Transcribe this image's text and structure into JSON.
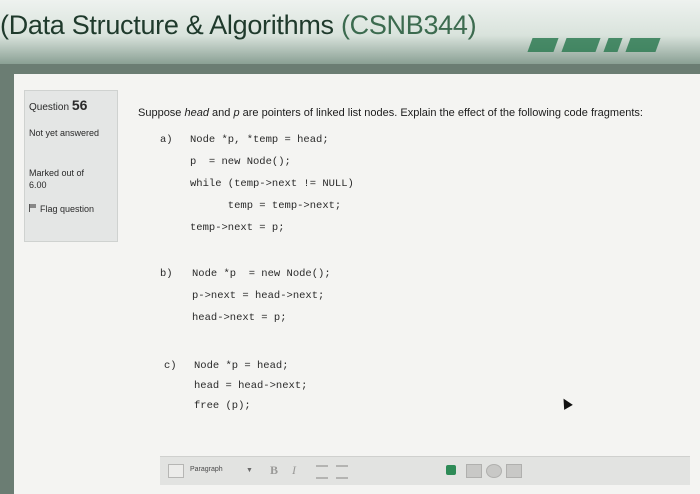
{
  "banner": {
    "title_main": "(Data Structure & Algorithms ",
    "title_code": "(CSNB344)"
  },
  "info": {
    "question_label": "Question",
    "question_number": "56",
    "status": "Not yet answered",
    "marked_out_of": "Marked out of",
    "marks": "6.00",
    "flag_label": "Flag question"
  },
  "prompt": {
    "before_head": "Suppose ",
    "head": "head",
    "mid": " and ",
    "p": "p",
    "after": " are pointers of linked list nodes. Explain the effect of the following code fragments:"
  },
  "fragments": {
    "a_label": "a)",
    "a_lines": [
      "Node *p, *temp = head;",
      "p  = new Node();",
      "while (temp->next != NULL)",
      "      temp = temp->next;",
      "temp->next = p;"
    ],
    "b_label": "b)",
    "b_lines": [
      "Node *p  = new Node();",
      "p->next = head->next;",
      "head->next = p;"
    ],
    "c_label": "c)",
    "c_lines": [
      "Node *p = head;",
      "head = head->next;",
      "free (p);"
    ]
  },
  "editor": {
    "paragraph_label": "Paragraph",
    "bold_label": "B",
    "italic_label": "I"
  },
  "icons": [
    "flag-icon",
    "dropdown-caret-icon",
    "bullet-list-icon",
    "numbered-list-icon",
    "image-icon",
    "media-icon",
    "link-icon",
    "pointer-cursor-icon"
  ],
  "colors": {
    "banner_text": "#1f3a2c",
    "accent_green": "#2f7b54"
  }
}
